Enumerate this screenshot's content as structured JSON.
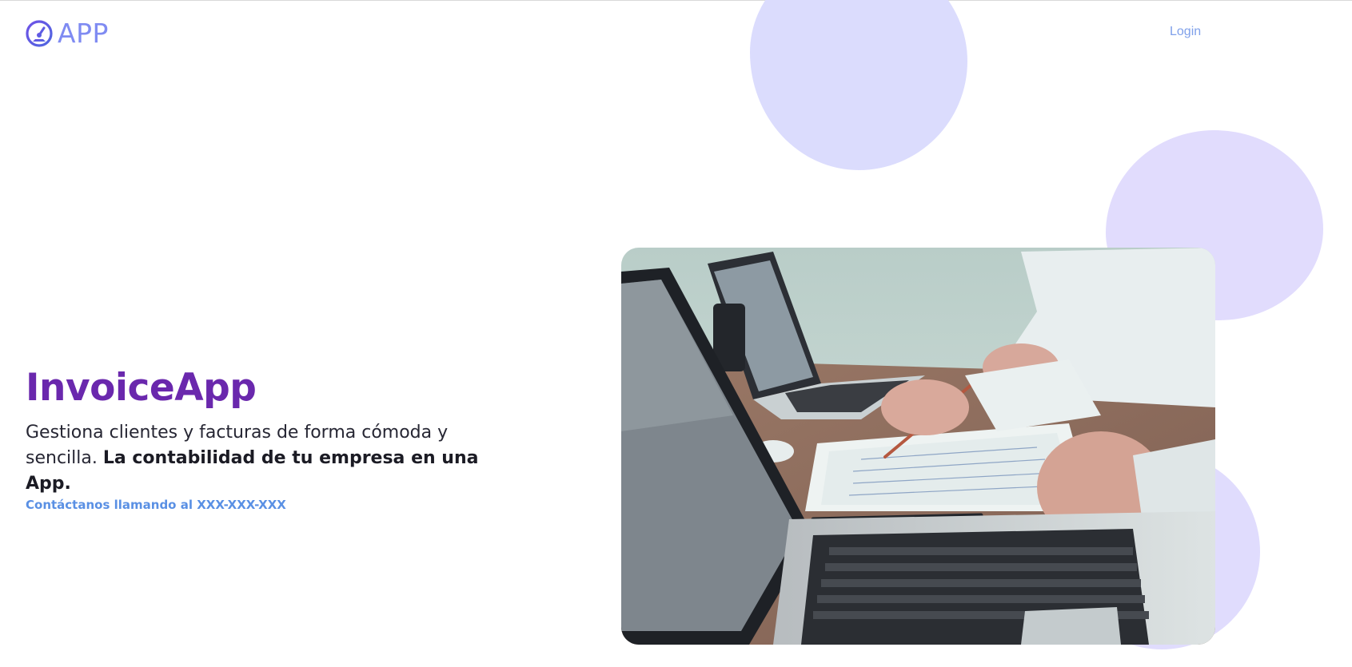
{
  "header": {
    "logo_text": "APP",
    "login_label": "Login"
  },
  "hero": {
    "title": "InvoiceApp",
    "description_plain": "Gestiona clientes y facturas de forma cómoda y sencilla.",
    "description_bold": "La contabilidad de tu empresa en una App.",
    "contact_text": "Contáctanos llamando al XXX-XXX-XXX"
  },
  "icons": {
    "logo_icon": "speedometer-icon"
  },
  "colors": {
    "brand": "#7f8bf2",
    "title": "#6a28ad",
    "link": "#5a90e4",
    "blob_light": "#dbdcfd"
  }
}
